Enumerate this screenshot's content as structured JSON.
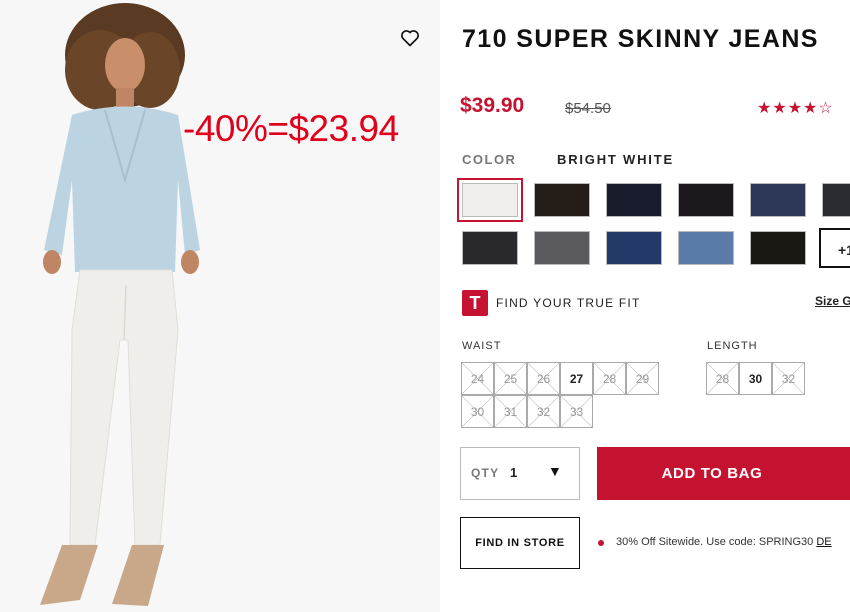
{
  "overlay": {
    "discount_text": "-40%=$23.94"
  },
  "product": {
    "title": "710 SUPER SKINNY JEANS",
    "price": "$39.90",
    "original_price": "$54.50",
    "rating_stars": "★★★★☆",
    "rating_value": 4.5
  },
  "color": {
    "label": "COLOR",
    "selected_name": "BRIGHT WHITE",
    "swatches": [
      "#f1efeb",
      "#241c17",
      "#181c2c",
      "#1b171c",
      "#2c3656",
      "#2a2c31",
      "#29292d",
      "#5a595d",
      "#233a68",
      "#5a7ba8",
      "#1a1812"
    ],
    "more_label": "+1"
  },
  "fit": {
    "badge": "T",
    "label": "FIND YOUR TRUE FIT",
    "size_guide": "Size G"
  },
  "waist": {
    "label": "WAIST",
    "sizes": [
      {
        "v": "24",
        "available": false
      },
      {
        "v": "25",
        "available": false
      },
      {
        "v": "26",
        "available": false
      },
      {
        "v": "27",
        "available": true
      },
      {
        "v": "28",
        "available": false
      },
      {
        "v": "29",
        "available": false
      },
      {
        "v": "30",
        "available": false
      },
      {
        "v": "31",
        "available": false
      },
      {
        "v": "32",
        "available": false
      },
      {
        "v": "33",
        "available": false
      }
    ]
  },
  "length": {
    "label": "LENGTH",
    "sizes": [
      {
        "v": "28",
        "available": false
      },
      {
        "v": "30",
        "available": true
      },
      {
        "v": "32",
        "available": false
      }
    ]
  },
  "qty": {
    "label": "QTY",
    "value": "1",
    "arrow": "▼"
  },
  "actions": {
    "add_to_bag": "ADD TO BAG",
    "find_in_store": "FIND IN STORE"
  },
  "promo": {
    "text": "30% Off Sitewide. Use code: SPRING30 ",
    "link": "DE"
  },
  "icons": {
    "favorite": "heart-icon"
  }
}
